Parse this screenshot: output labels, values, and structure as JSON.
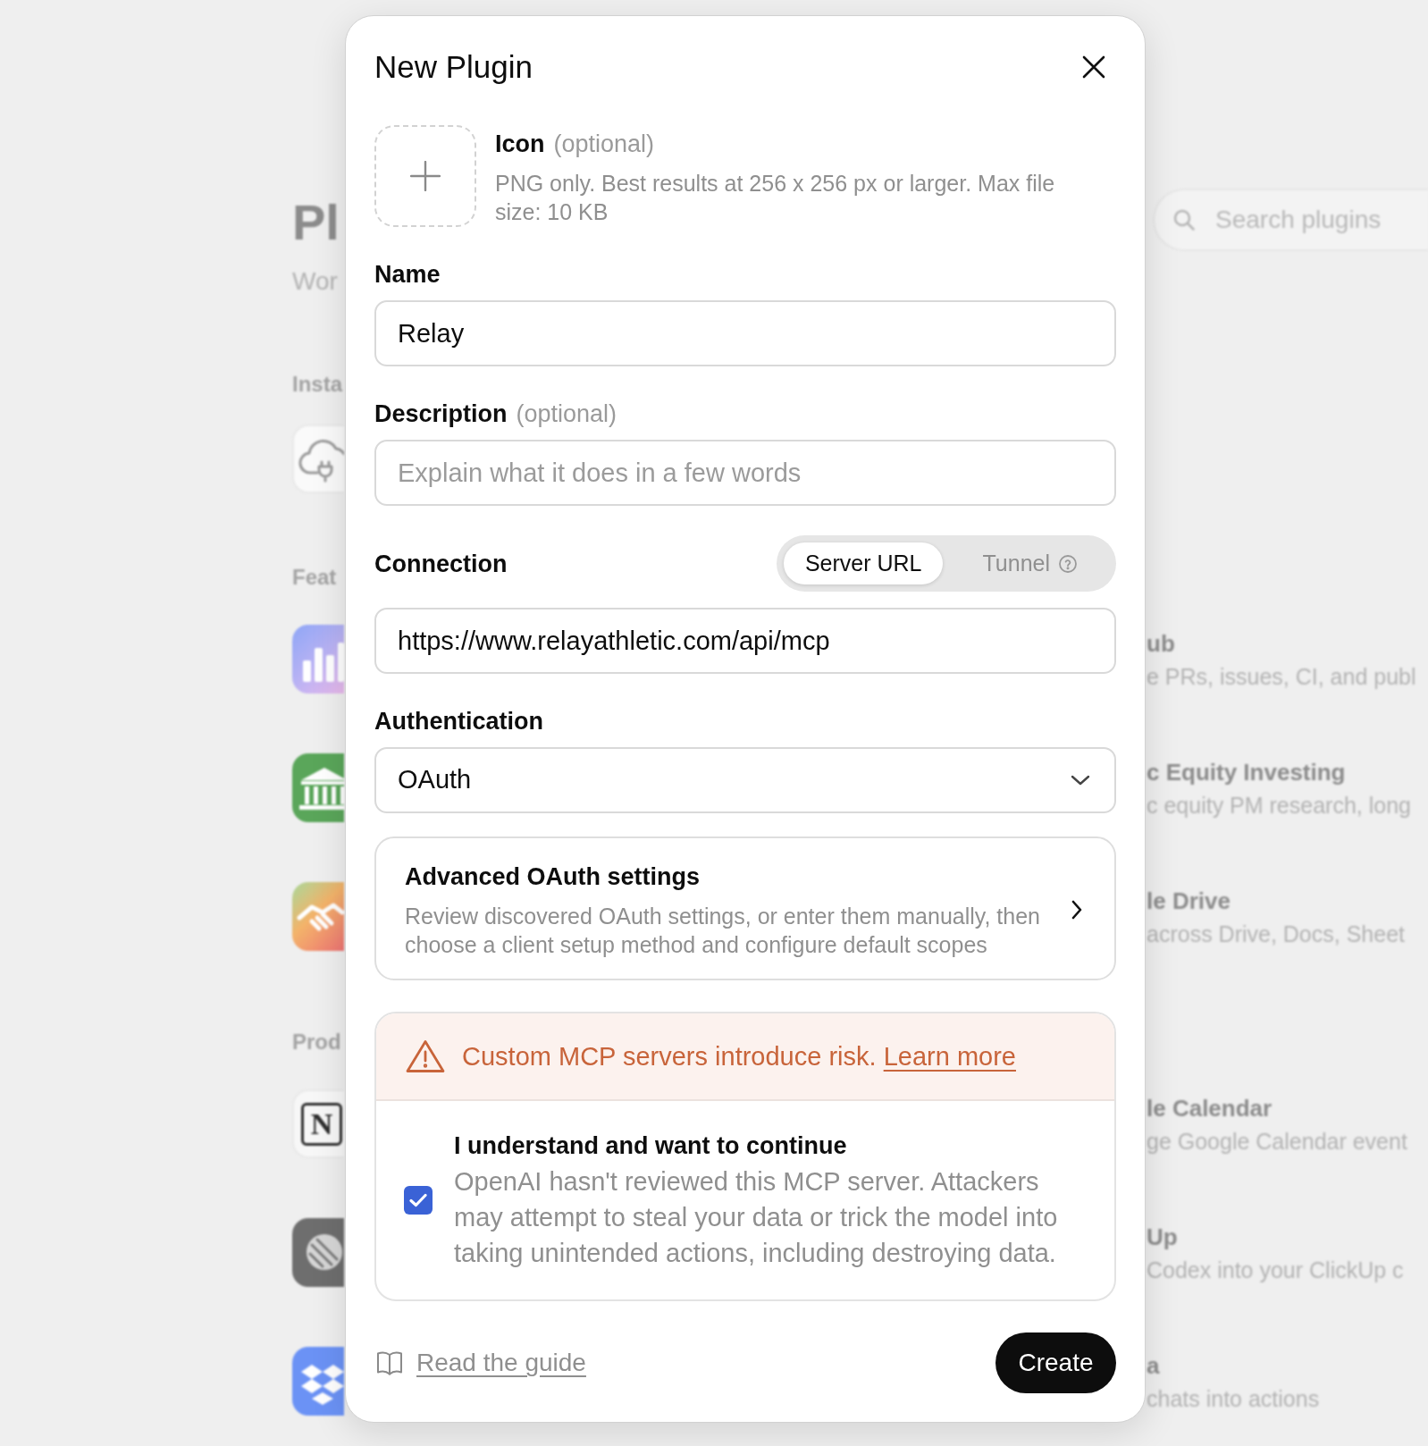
{
  "background_page": {
    "title": "Pl",
    "subtitle": "Wor",
    "search": {
      "placeholder": "Search plugins"
    },
    "sections": [
      {
        "heading": "Insta"
      },
      {
        "heading": "Feat",
        "rows": [
          {
            "name": "ub",
            "description": "e PRs, issues, CI, and publ"
          },
          {
            "name": "c Equity Investing",
            "description": "c equity PM research, long"
          },
          {
            "name": "le Drive",
            "description": "across Drive, Docs, Sheet"
          }
        ]
      },
      {
        "heading": "Prod",
        "rows": [
          {
            "logo_letter": "N",
            "name": "le Calendar",
            "description": "ge Google Calendar event"
          },
          {
            "name": "Up",
            "description": "Codex into your ClickUp c"
          },
          {
            "name": "a",
            "description": "chats into actions"
          }
        ]
      }
    ]
  },
  "dialog": {
    "title": "New Plugin",
    "icon_upload": {
      "label": "Icon",
      "optional": "(optional)",
      "hint": "PNG only. Best results at 256 x 256 px or larger. Max file size: 10 KB"
    },
    "name_field": {
      "label": "Name",
      "value": "Relay"
    },
    "description_field": {
      "label": "Description",
      "optional": "(optional)",
      "placeholder": "Explain what it does in a few words"
    },
    "connection": {
      "label": "Connection",
      "options": [
        {
          "label": "Server URL",
          "selected": true,
          "help": false
        },
        {
          "label": "Tunnel",
          "selected": false,
          "help": true
        }
      ],
      "url": {
        "value": "https://www.relayathletic.com/api/mcp"
      }
    },
    "authentication": {
      "label": "Authentication",
      "value": "OAuth"
    },
    "advanced_settings": {
      "title": "Advanced OAuth settings",
      "description": "Review discovered OAuth settings, or enter them manually, then choose a client setup method and configure default scopes"
    },
    "warning": {
      "message": "Custom MCP servers introduce risk.",
      "link": "Learn more"
    },
    "acknowledgement": {
      "checked": true,
      "title": "I understand and want to continue",
      "description": "OpenAI hasn't reviewed this MCP server. Attackers may attempt to steal your data or trick the model into taking unintended actions, including destroying data."
    },
    "guide_link": "Read the guide",
    "create_button": "Create"
  }
}
